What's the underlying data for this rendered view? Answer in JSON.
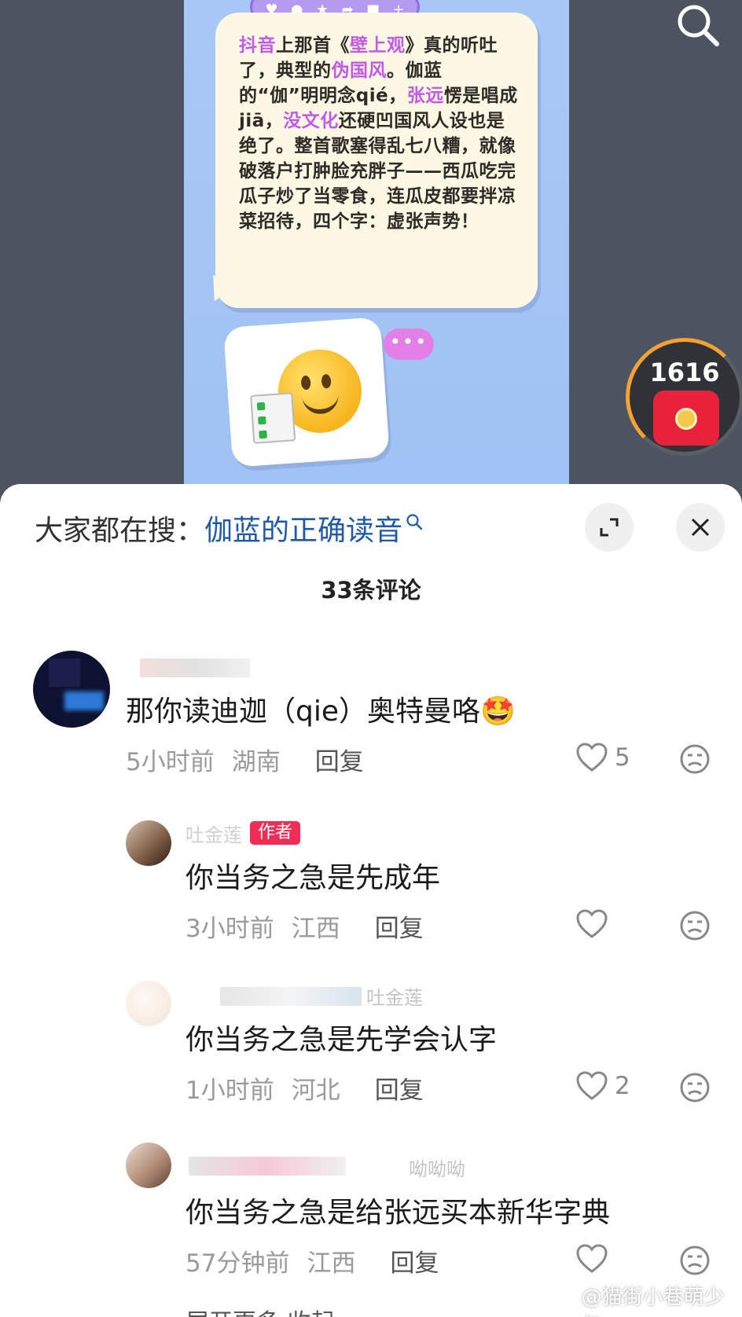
{
  "video": {
    "bubble_segments": [
      {
        "text": "抖音",
        "hl": true
      },
      {
        "text": "上那首《",
        "hl": false
      },
      {
        "text": "壁上观",
        "hl": true
      },
      {
        "text": "》真的听吐了，典型的",
        "hl": false
      },
      {
        "text": "伪国风",
        "hl": true
      },
      {
        "text": "。伽蓝的“伽”明明念qié，",
        "hl": false
      },
      {
        "text": "张远",
        "hl": true
      },
      {
        "text": "愣是唱成jiā，",
        "hl": false
      },
      {
        "text": "没文化",
        "hl": true
      },
      {
        "text": "还硬凹国风人设也是绝了。整首歌塞得乱七八糟，就像破落户打肿脸充胖子——西瓜吃完瓜子炒了当零食，连瓜皮都要拌凉菜招待，四个字：虚张声势！",
        "hl": false
      }
    ],
    "toolbar_icons": [
      "heart-icon",
      "comment-icon",
      "star-icon",
      "share-icon",
      "folder-icon",
      "plus-icon"
    ],
    "dots": "•••",
    "packet_count": "1616"
  },
  "sheet": {
    "suggest_prefix": "大家都在搜：",
    "suggest_query": "伽蓝的正确读音",
    "comment_count": "33条评论",
    "comments": [
      {
        "text": "那你读迪迦（qie）奥特曼咯",
        "emoji": "🤩",
        "time": "5小时前",
        "location": "湖南",
        "reply": "回复",
        "likes": "5"
      },
      {
        "name_partial": "吐金莲",
        "badge": "作者",
        "text": "你当务之急是先成年",
        "time": "3小时前",
        "location": "江西",
        "reply": "回复",
        "likes": ""
      },
      {
        "name_partial": "吐金莲",
        "text": "你当务之急是先学会认字",
        "time": "1小时前",
        "location": "河北",
        "reply": "回复",
        "likes": "2"
      },
      {
        "name_partial": "呦呦呦",
        "text": "你当务之急是给张远买本新华字典",
        "time": "57分钟前",
        "location": "江西",
        "reply": "回复",
        "likes": ""
      }
    ],
    "bottom_peek": "展开更多 收起"
  },
  "watermark": "@猫街小巷萌少年",
  "colors": {
    "highlight": "#c25ae8",
    "query_blue": "#1e5aa8",
    "author_badge": "#ef2d57",
    "packet_ring": "#f3a233"
  }
}
